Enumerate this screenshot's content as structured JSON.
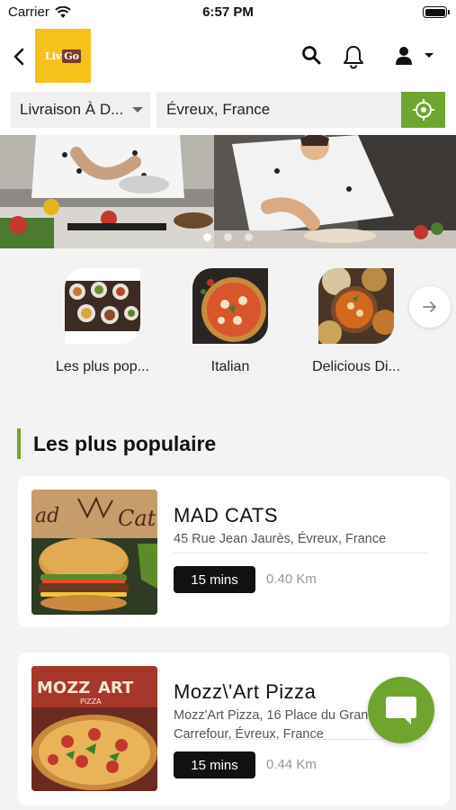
{
  "status_bar": {
    "carrier": "Carrier",
    "time": "6:57 PM"
  },
  "header": {
    "logo_text": "Liv",
    "logo_badge": "Go"
  },
  "filters": {
    "delivery_mode": "Livraison À D...",
    "address": "Évreux, France"
  },
  "banner": {
    "slide_count": 3,
    "active_slide": 1
  },
  "categories": [
    {
      "label": "Les plus pop..."
    },
    {
      "label": "Italian"
    },
    {
      "label": "Delicious Di..."
    }
  ],
  "section": {
    "title": "Les plus populaire"
  },
  "restaurants": [
    {
      "name": "MAD CATS",
      "address": "45 Rue Jean Jaurès, Évreux, France",
      "time": "15 mins",
      "distance": "0.40 Km"
    },
    {
      "name": "Mozz\\'Art Pizza",
      "address": "Mozz'Art Pizza, 16 Place du Grand Carrefour, Évreux, France",
      "time": "15 mins",
      "distance": "0.44 Km"
    }
  ],
  "colors": {
    "accent": "#6fa52e",
    "logo_bg": "#f6c11a",
    "chip": "#111111"
  }
}
